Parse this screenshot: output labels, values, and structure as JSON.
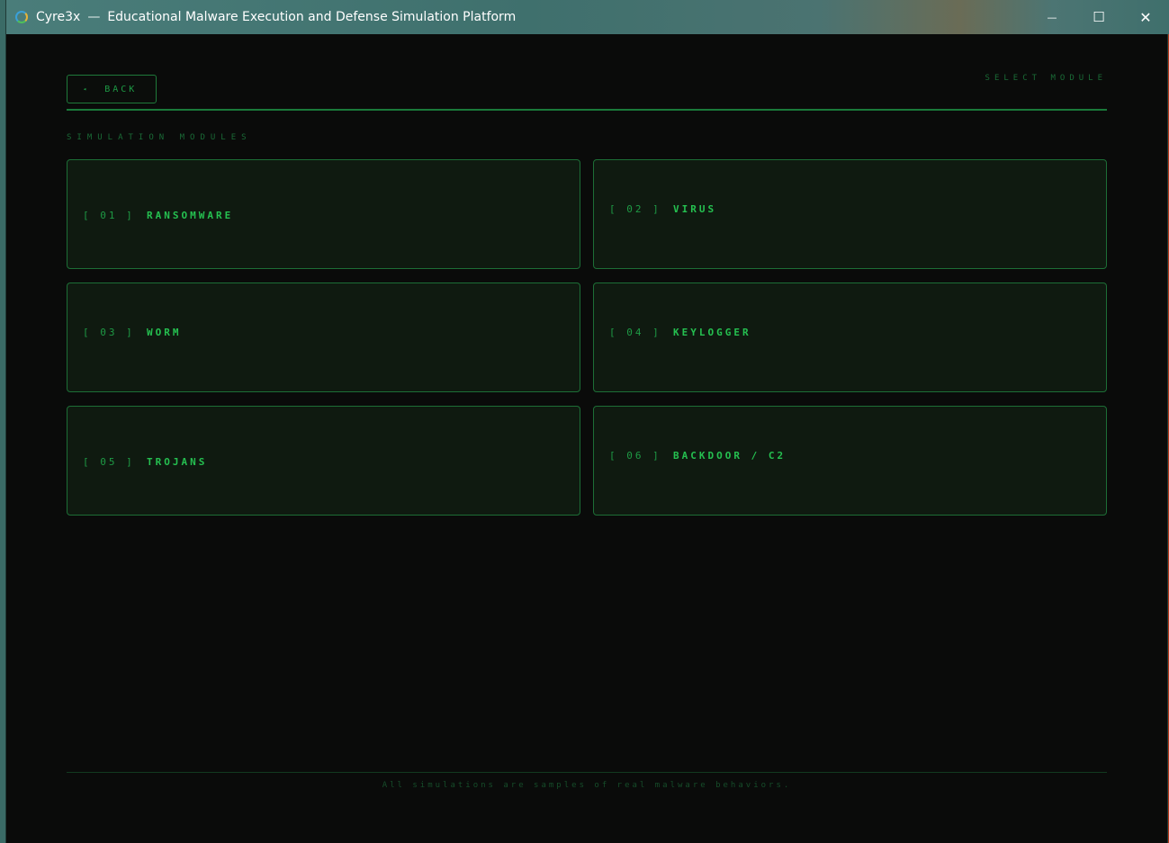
{
  "window": {
    "app_name": "Cyre3x",
    "separator": "—",
    "title": "Educational Malware Execution and Defense Simulation Platform",
    "minimize_glyph": "—",
    "maximize_glyph": "☐",
    "close_glyph": "✕"
  },
  "header": {
    "back_arrow": "◂",
    "back_label": "BACK",
    "select_module": "SELECT MODULE"
  },
  "section_label": "SIMULATION MODULES",
  "modules": [
    {
      "number": "[ 01 ]",
      "name": "RANSOMWARE"
    },
    {
      "number": "[ 02 ]",
      "name": "VIRUS"
    },
    {
      "number": "[ 03 ]",
      "name": "WORM"
    },
    {
      "number": "[ 04 ]",
      "name": "KEYLOGGER"
    },
    {
      "number": "[ 05 ]",
      "name": "TROJANS"
    },
    {
      "number": "[ 06 ]",
      "name": "BACKDOOR / C2"
    }
  ],
  "footer": {
    "note": "All simulations are samples of real malware behaviors."
  },
  "colors": {
    "accent": "#22b04c",
    "border": "#1d6e36",
    "background": "#0a0b0a",
    "card_background": "#0f1a10"
  },
  "icons": {
    "app": "cyre3x-logo-icon",
    "back": "triangle-left-icon"
  }
}
